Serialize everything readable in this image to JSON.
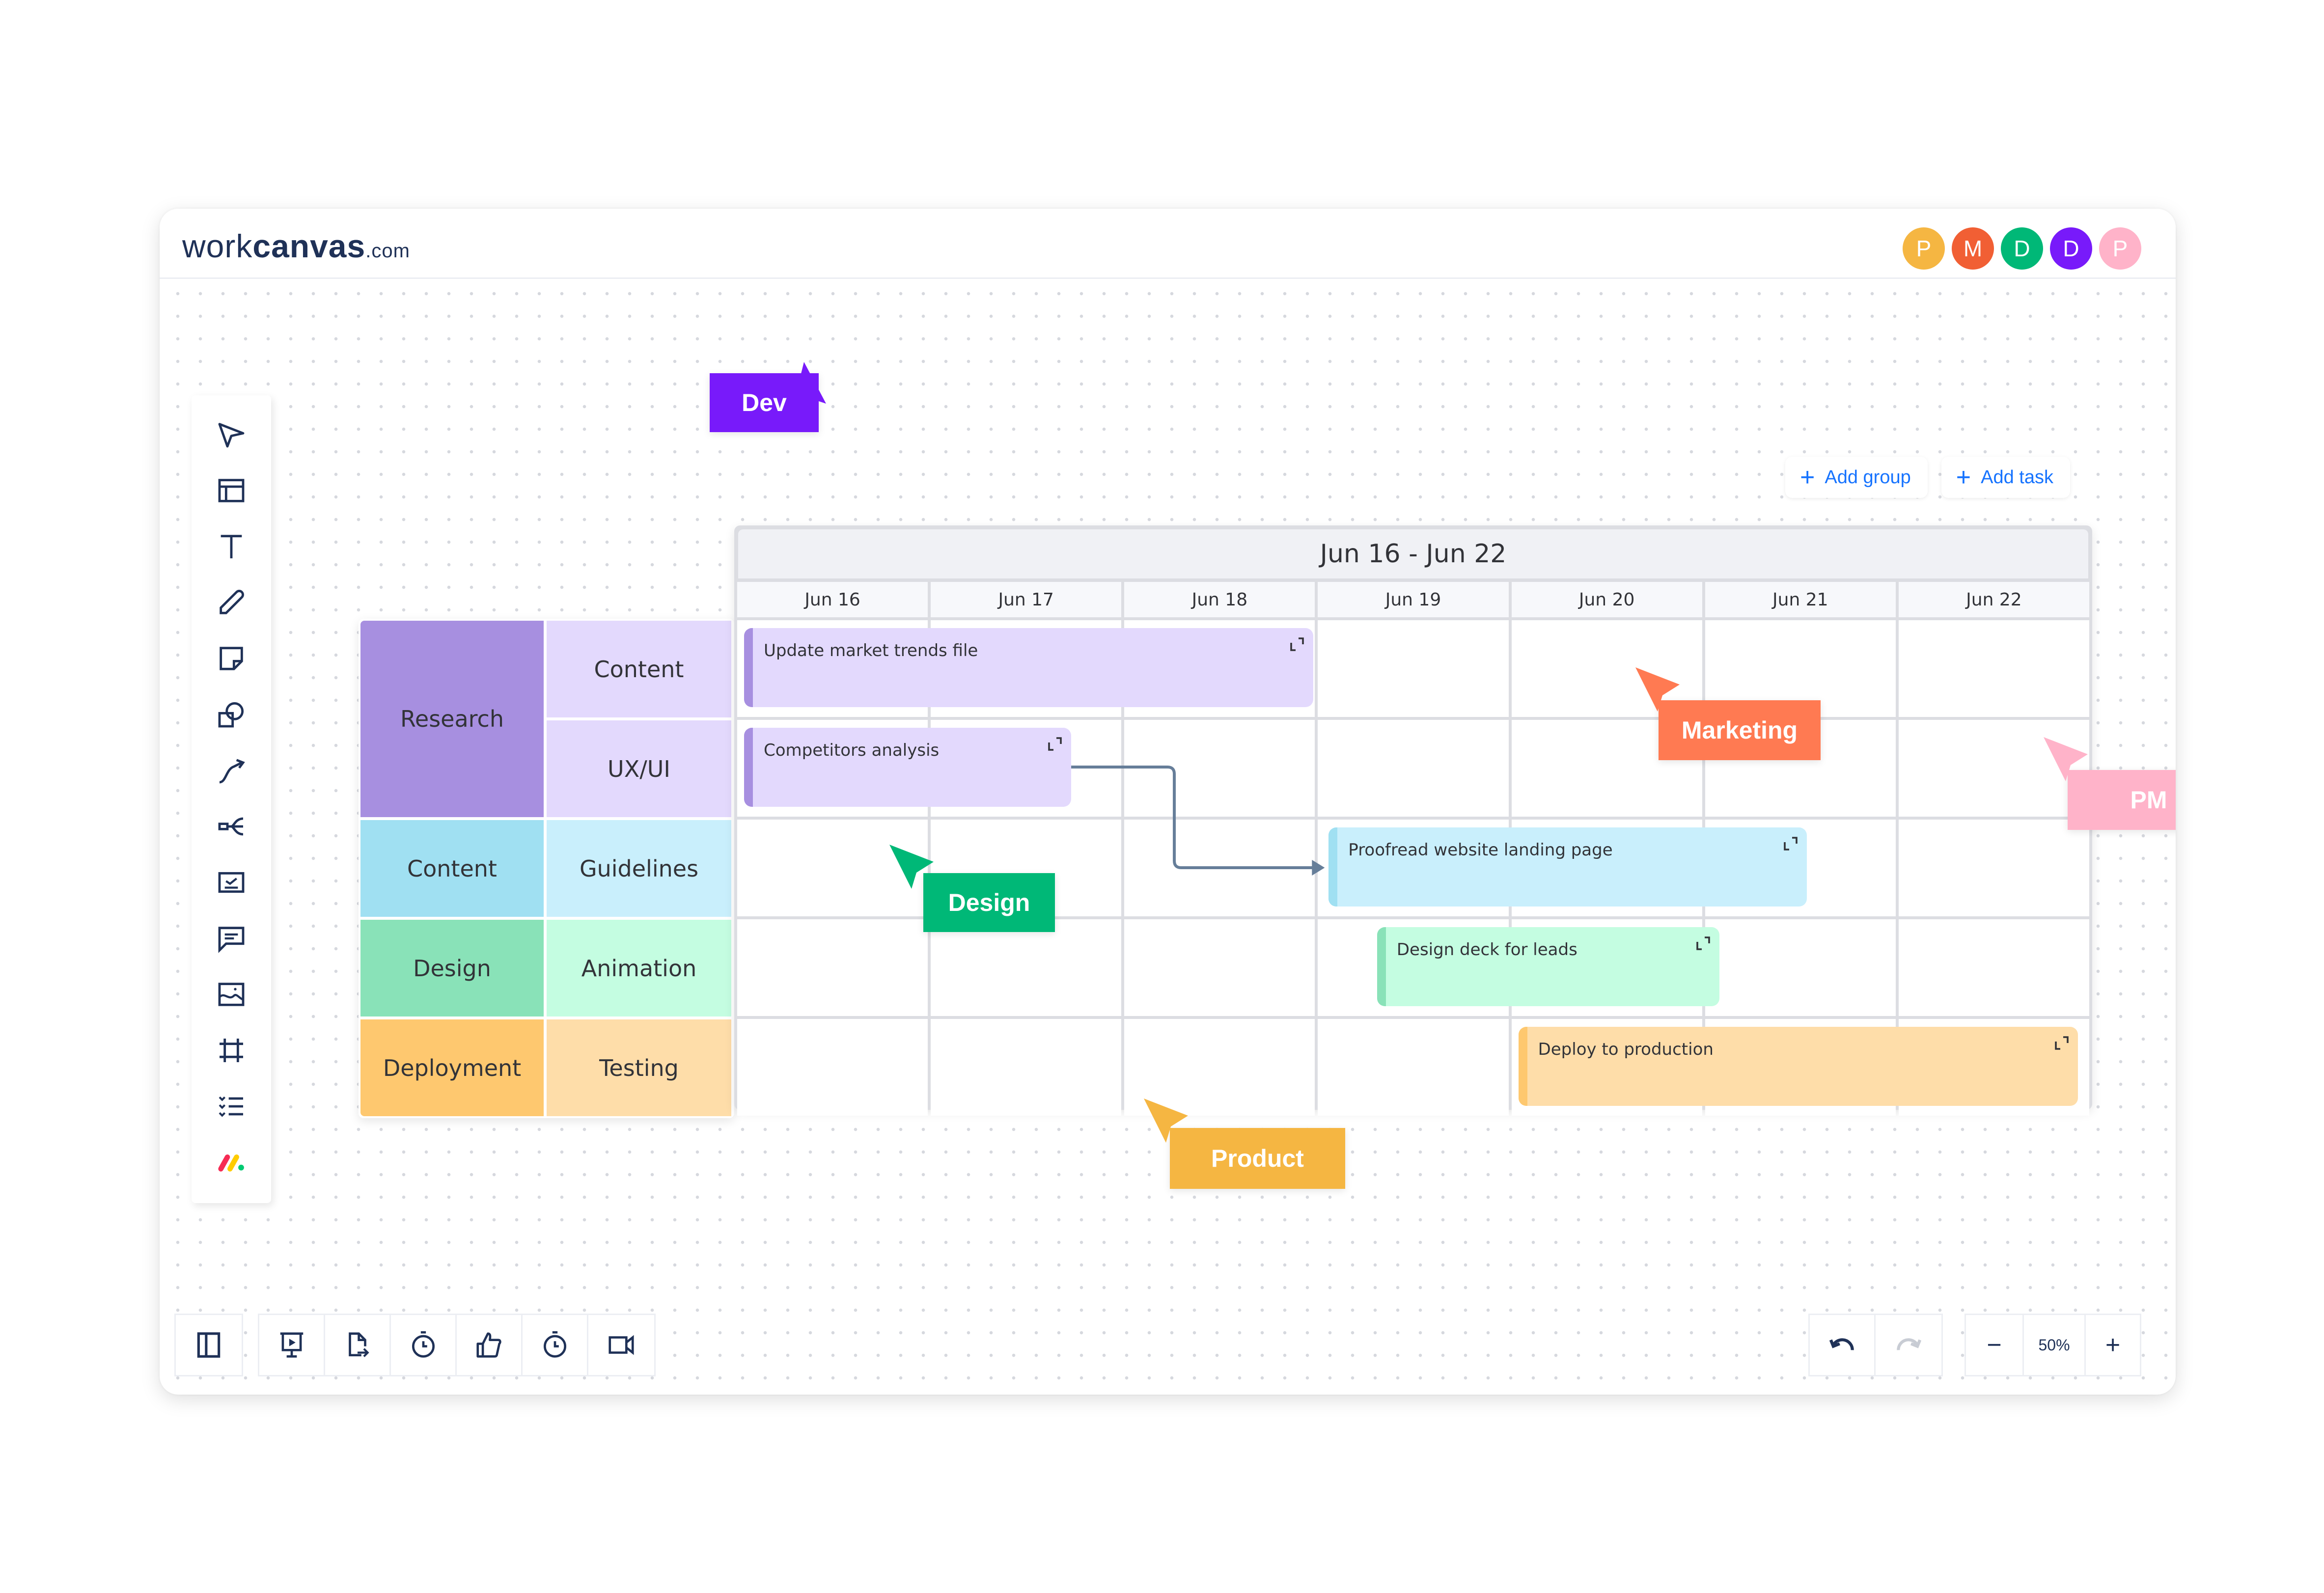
{
  "app": {
    "logo": {
      "prefix": "work",
      "bold": "canvas",
      "suffix": ".com"
    },
    "avatars": [
      {
        "initial": "P",
        "color": "#f5b642"
      },
      {
        "initial": "M",
        "color": "#f15f34"
      },
      {
        "initial": "D",
        "color": "#00b877"
      },
      {
        "initial": "D",
        "color": "#781afa"
      },
      {
        "initial": "P",
        "color": "#ffb3c9"
      }
    ]
  },
  "toolbar": {
    "tools": [
      {
        "name": "select-tool",
        "icon": "cursor-arrow-icon"
      },
      {
        "name": "template-tool",
        "icon": "layout-icon"
      },
      {
        "name": "text-tool",
        "icon": "text-icon"
      },
      {
        "name": "pen-tool",
        "icon": "pencil-icon"
      },
      {
        "name": "sticky-note-tool",
        "icon": "sticky-note-icon"
      },
      {
        "name": "shapes-tool",
        "icon": "shapes-icon"
      },
      {
        "name": "connector-tool",
        "icon": "connector-arrow-icon"
      },
      {
        "name": "mindmap-tool",
        "icon": "mindmap-icon"
      },
      {
        "name": "task-tool",
        "icon": "checkbox-card-icon"
      },
      {
        "name": "comment-tool",
        "icon": "comment-icon"
      },
      {
        "name": "image-tool",
        "icon": "image-icon"
      },
      {
        "name": "frame-tool",
        "icon": "frame-icon"
      },
      {
        "name": "list-tool",
        "icon": "checklist-icon"
      },
      {
        "name": "monday-integration",
        "icon": "monday-logo-icon"
      }
    ]
  },
  "actions": {
    "add_group": "Add group",
    "add_task": "Add task"
  },
  "timeline": {
    "range_title": "Jun 16 - Jun 22",
    "days": [
      "Jun 16",
      "Jun 17",
      "Jun 18",
      "Jun 19",
      "Jun 20",
      "Jun 21",
      "Jun 22"
    ]
  },
  "groups": [
    {
      "label": "Research",
      "color": "#a78fe0",
      "subs": [
        {
          "label": "Content",
          "color": "#e3d9fd"
        },
        {
          "label": "UX/UI",
          "color": "#e3d9fd"
        }
      ]
    },
    {
      "label": "Content",
      "color": "#a0e0f2",
      "subs": [
        {
          "label": "Guidelines",
          "color": "#c9effc"
        }
      ]
    },
    {
      "label": "Design",
      "color": "#89e2b8",
      "subs": [
        {
          "label": "Animation",
          "color": "#c4fde1"
        }
      ]
    },
    {
      "label": "Deployment",
      "color": "#fec86f",
      "subs": [
        {
          "label": "Testing",
          "color": "#fedda9"
        }
      ]
    }
  ],
  "tasks": [
    {
      "title": "Update market trends file",
      "row": 0,
      "start_day": 0,
      "end_day": 2.95,
      "bg": "#e3d9fd",
      "accent": "#a78fe0"
    },
    {
      "title": "Competitors analysis",
      "row": 1,
      "start_day": 0,
      "end_day": 1.7,
      "bg": "#e3d9fd",
      "accent": "#a78fe0"
    },
    {
      "title": "Proofread website landing page",
      "row": 2,
      "start_day": 3.02,
      "end_day": 5.5,
      "bg": "#c9effc",
      "accent": "#a0e0f2"
    },
    {
      "title": "Design deck for leads",
      "row": 3,
      "start_day": 3.27,
      "end_day": 5.05,
      "bg": "#c4fde1",
      "accent": "#89e2b8"
    },
    {
      "title": "Deploy to production",
      "row": 4,
      "start_day": 4.0,
      "end_day": 6.9,
      "bg": "#fedda9",
      "accent": "#fec86f"
    }
  ],
  "dependencies": [
    {
      "from": "Competitors analysis",
      "to": "Proofread website landing page",
      "color": "#667e99"
    }
  ],
  "cursors": [
    {
      "label": "Dev",
      "color": "#781afa"
    },
    {
      "label": "Marketing",
      "color": "#ff7a52"
    },
    {
      "label": "PM",
      "color": "#ffb3c9"
    },
    {
      "label": "Design",
      "color": "#00b877"
    },
    {
      "label": "Product",
      "color": "#f5b642"
    }
  ],
  "bottombar": {
    "left_tools": [
      {
        "name": "toggle-panel-button",
        "icon": "sidebar-panel-icon"
      },
      {
        "name": "present-button",
        "icon": "presentation-icon"
      },
      {
        "name": "export-button",
        "icon": "file-export-icon"
      },
      {
        "name": "timer-button",
        "icon": "stopwatch-icon"
      },
      {
        "name": "vote-button",
        "icon": "thumbs-up-icon"
      },
      {
        "name": "stopwatch-button",
        "icon": "stopwatch-icon"
      },
      {
        "name": "video-button",
        "icon": "video-camera-icon"
      }
    ],
    "zoom_level": "50%",
    "zoom_out": "−",
    "zoom_in": "+"
  }
}
